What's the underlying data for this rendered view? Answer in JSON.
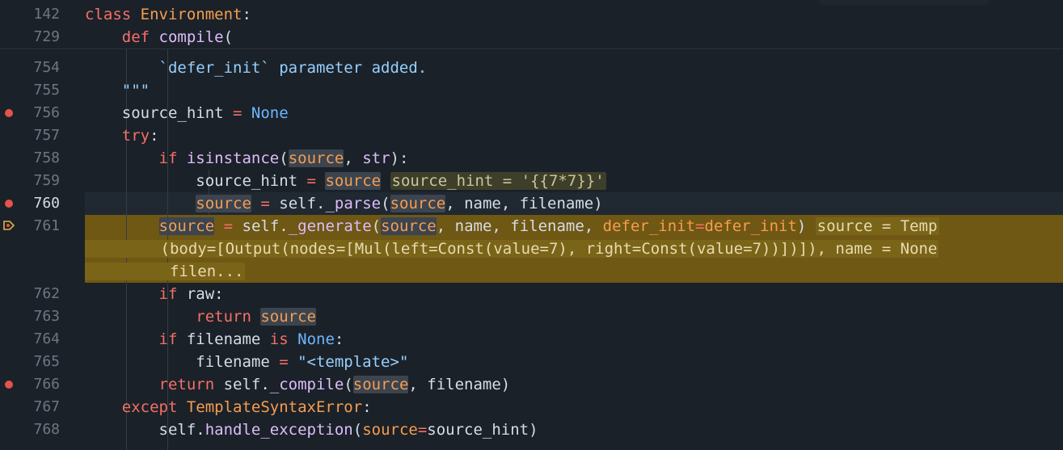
{
  "sticky": [
    {
      "num": "142",
      "parts": [
        [
          "kw",
          "class "
        ],
        [
          "cls",
          "Environment"
        ],
        [
          "var",
          ":"
        ]
      ]
    },
    {
      "num": "729",
      "parts": [
        [
          "var",
          "    "
        ],
        [
          "kw",
          "def "
        ],
        [
          "fn",
          "compile"
        ],
        [
          "par",
          "("
        ]
      ]
    }
  ],
  "lines": [
    {
      "num": "754",
      "bp": false,
      "parts": [
        [
          "str",
          "        `defer_init` parameter added."
        ]
      ]
    },
    {
      "num": "755",
      "bp": false,
      "parts": [
        [
          "str",
          "    \"\"\""
        ]
      ]
    },
    {
      "num": "756",
      "bp": true,
      "parts": [
        [
          "var",
          "    source_hint "
        ],
        [
          "op",
          "= "
        ],
        [
          "bi",
          "None"
        ]
      ]
    },
    {
      "num": "757",
      "bp": false,
      "parts": [
        [
          "var",
          "    "
        ],
        [
          "kw",
          "try"
        ],
        [
          "var",
          ":"
        ]
      ]
    },
    {
      "num": "758",
      "bp": false,
      "parts": [
        [
          "var",
          "        "
        ],
        [
          "kw",
          "if "
        ],
        [
          "fn",
          "isinstance"
        ],
        [
          "par",
          "("
        ],
        [
          "arg",
          "source",
          "ref"
        ],
        [
          "var",
          ", "
        ],
        [
          "fn",
          "str"
        ],
        [
          "par",
          "):"
        ]
      ]
    },
    {
      "num": "759",
      "bp": false,
      "parts": [
        [
          "var",
          "            source_hint "
        ],
        [
          "op",
          "= "
        ],
        [
          "arg",
          "source",
          "ref"
        ],
        [
          "var",
          " "
        ],
        [
          "hint",
          "source_hint = '{{7*7}}'",
          "hint"
        ]
      ]
    },
    {
      "num": "760",
      "bp": true,
      "current": true,
      "parts": [
        [
          "var",
          "            "
        ],
        [
          "arg",
          "source",
          "ref"
        ],
        [
          "var",
          " "
        ],
        [
          "op",
          "= "
        ],
        [
          "var",
          "self."
        ],
        [
          "fn",
          "_parse"
        ],
        [
          "par",
          "("
        ],
        [
          "arg",
          "source",
          "ref"
        ],
        [
          "var",
          ", name, filename"
        ],
        [
          "par",
          ")"
        ]
      ]
    },
    {
      "num": "761",
      "bp": false,
      "exec": true,
      "parts": [
        [
          "var",
          "        "
        ],
        [
          "arg",
          "source",
          "ref"
        ],
        [
          "var",
          " "
        ],
        [
          "op",
          "= "
        ],
        [
          "var",
          "self."
        ],
        [
          "fn",
          "_generate"
        ],
        [
          "par",
          "("
        ],
        [
          "arg",
          "source",
          "ref"
        ],
        [
          "var",
          ", name, filename, "
        ],
        [
          "arg",
          "defer_init"
        ],
        [
          "op",
          "="
        ],
        [
          "arg",
          "defer_init"
        ],
        [
          "par",
          ")"
        ],
        [
          "var",
          " "
        ],
        [
          "hint",
          "source = Temp",
          "hintexec"
        ]
      ]
    },
    {
      "num": "",
      "bp": false,
      "cont": true,
      "parts": [
        [
          "hint",
          "        (body=[Output(nodes=[Mul(left=Const(value=7), right=Const(value=7))])]), name = None",
          "hintexec"
        ]
      ]
    },
    {
      "num": "",
      "bp": false,
      "cont": true,
      "parts": [
        [
          "hint",
          "         filen...",
          "hintexec"
        ]
      ]
    },
    {
      "num": "762",
      "bp": false,
      "parts": [
        [
          "var",
          "        "
        ],
        [
          "kw",
          "if "
        ],
        [
          "var",
          "raw:"
        ]
      ]
    },
    {
      "num": "763",
      "bp": false,
      "parts": [
        [
          "var",
          "            "
        ],
        [
          "kw",
          "return "
        ],
        [
          "arg",
          "source",
          "ref"
        ]
      ]
    },
    {
      "num": "764",
      "bp": false,
      "parts": [
        [
          "var",
          "        "
        ],
        [
          "kw",
          "if "
        ],
        [
          "var",
          "filename "
        ],
        [
          "kw",
          "is "
        ],
        [
          "bi",
          "None"
        ],
        [
          "var",
          ":"
        ]
      ]
    },
    {
      "num": "765",
      "bp": false,
      "parts": [
        [
          "var",
          "            filename "
        ],
        [
          "op",
          "= "
        ],
        [
          "str",
          "\"<template>\""
        ]
      ]
    },
    {
      "num": "766",
      "bp": true,
      "parts": [
        [
          "var",
          "        "
        ],
        [
          "kw",
          "return "
        ],
        [
          "var",
          "self."
        ],
        [
          "fn",
          "_compile"
        ],
        [
          "par",
          "("
        ],
        [
          "arg",
          "source",
          "ref"
        ],
        [
          "var",
          ", filename"
        ],
        [
          "par",
          ")"
        ]
      ]
    },
    {
      "num": "767",
      "bp": false,
      "parts": [
        [
          "var",
          "    "
        ],
        [
          "kw",
          "except "
        ],
        [
          "cls",
          "TemplateSyntaxError"
        ],
        [
          "var",
          ":"
        ]
      ]
    },
    {
      "num": "768",
      "bp": false,
      "parts": [
        [
          "var",
          "        self."
        ],
        [
          "fn",
          "handle_exception"
        ],
        [
          "par",
          "("
        ],
        [
          "arg",
          "source"
        ],
        [
          "op",
          "="
        ],
        [
          "var",
          "source_hint"
        ],
        [
          "par",
          ")"
        ]
      ]
    }
  ],
  "colors": {
    "background": "#1b2128",
    "exec_highlight": "#6f5714",
    "breakpoint": "#e5534b",
    "keyword": "#f47067",
    "class_name": "#f69d50",
    "function": "#dcbdfb",
    "builtin_const": "#6cb6ff",
    "string": "#96d0ff"
  },
  "icons": {
    "breakpoint": "breakpoint-icon",
    "execution_pointer": "execution-pointer-icon"
  }
}
